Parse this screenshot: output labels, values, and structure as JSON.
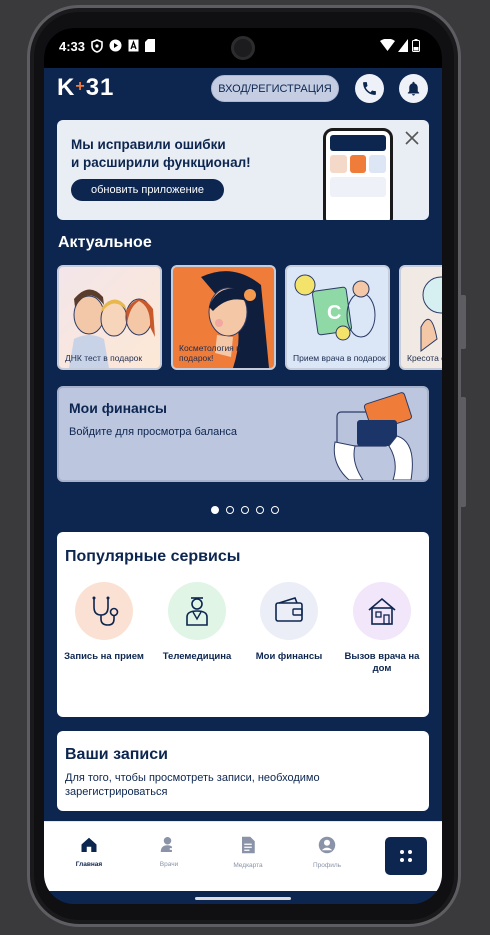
{
  "status": {
    "time": "4:33"
  },
  "header": {
    "logo_k": "K",
    "logo_plus": "+",
    "logo_num": "31",
    "login_label": "ВХОД/РЕГИСТРАЦИЯ"
  },
  "banner": {
    "line1": "Мы исправили ошибки",
    "line2": "и расширили функционал!",
    "button": "обновить приложение"
  },
  "actual": {
    "title": "Актуальное",
    "cards": [
      {
        "label": "ДНК тест в подарок"
      },
      {
        "label": "Косметология в подарок!"
      },
      {
        "label": "Прием врача в подарок"
      },
      {
        "label": "Кресота смотрящ"
      }
    ]
  },
  "finance": {
    "title": "Мои финансы",
    "subtitle": "Войдите для просмотра баланса"
  },
  "carousel": {
    "active_index": 0,
    "count": 5
  },
  "services": {
    "title": "Популярные сервисы",
    "items": [
      {
        "label": "Запись на прием",
        "icon": "stethoscope-icon",
        "bg": "#fbe1d3"
      },
      {
        "label": "Телемедицина",
        "icon": "doctor-icon",
        "bg": "#e0f5e6"
      },
      {
        "label": "Мои финансы",
        "icon": "wallet-icon",
        "bg": "#eceef7"
      },
      {
        "label": "Вызов врача на дом",
        "icon": "house-icon",
        "bg": "#f1e6fa"
      }
    ]
  },
  "records": {
    "title": "Ваши записи",
    "subtitle": "Для того, чтобы просмотреть записи, необходимо зарегистрироваться"
  },
  "tabbar": {
    "items": [
      {
        "label": "Главная",
        "icon": "home-icon",
        "active": true
      },
      {
        "label": "Врачи",
        "icon": "doctor-add-icon",
        "active": false
      },
      {
        "label": "Медкарта",
        "icon": "medcard-icon",
        "active": false
      },
      {
        "label": "Профиль",
        "icon": "profile-icon",
        "active": false
      }
    ]
  },
  "colors": {
    "primary": "#0d2650",
    "accent": "#f07c3a",
    "background": "#0d2650"
  }
}
